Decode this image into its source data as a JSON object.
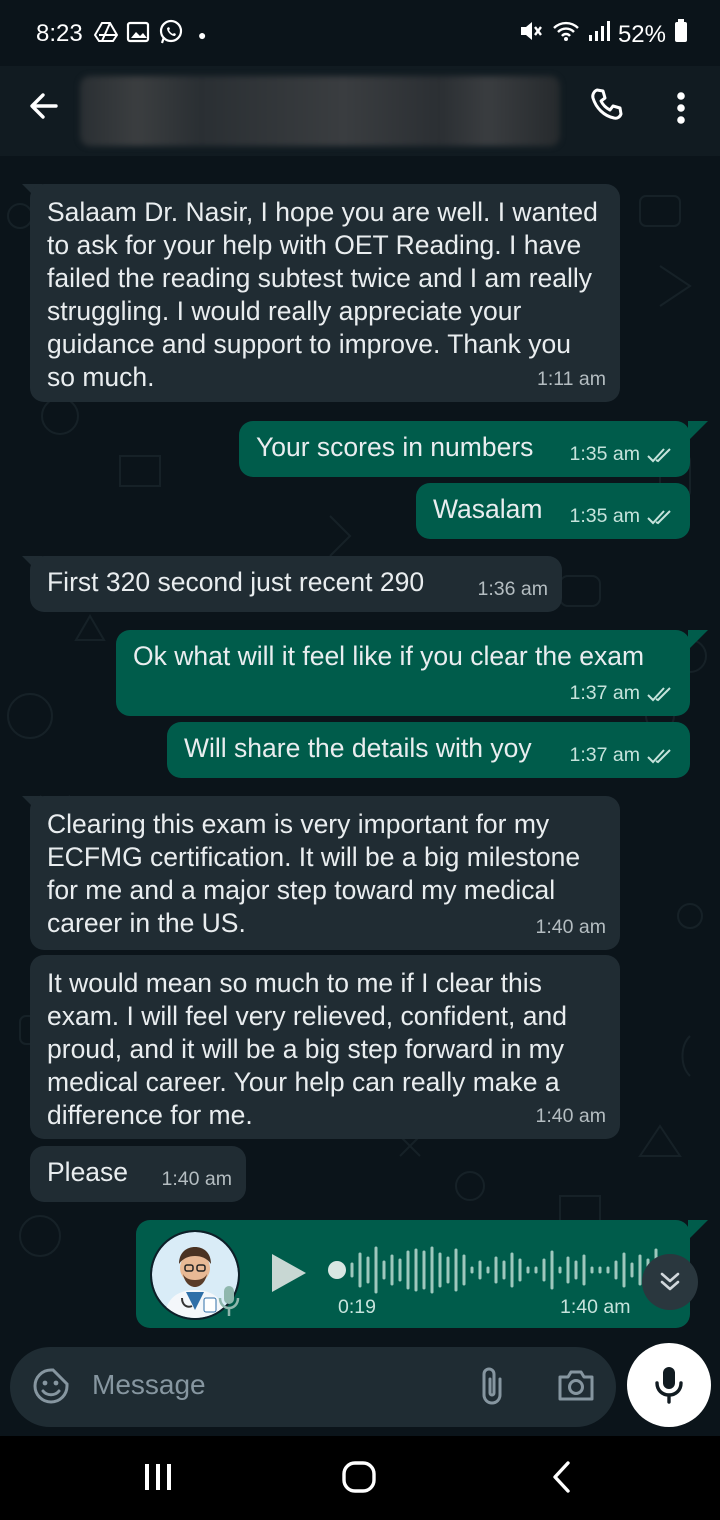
{
  "status_bar": {
    "time": "8:23",
    "battery": "52%"
  },
  "header": {
    "contact_name": ""
  },
  "messages": [
    {
      "dir": "in",
      "text": "Salaam Dr. Nasir, I hope you are well. I wanted to ask for your help with OET Reading. I have failed the reading subtest twice and I am really struggling. I would really appreciate your guidance and support to improve. Thank you so much.",
      "time": "1:11 am"
    },
    {
      "dir": "out",
      "text": "Your scores in numbers",
      "time": "1:35 am",
      "read": true
    },
    {
      "dir": "out",
      "text": "Wasalam",
      "time": "1:35 am",
      "read": true
    },
    {
      "dir": "in",
      "text": "First 320 second just recent 290",
      "time": "1:36 am"
    },
    {
      "dir": "out",
      "text": "Ok what will it feel like if you clear the exam",
      "time": "1:37 am",
      "read": true
    },
    {
      "dir": "out",
      "text": "Will share the details with yoy",
      "time": "1:37 am",
      "read": true
    },
    {
      "dir": "in",
      "text": "Clearing this exam is very important for my ECFMG certification. It will be a big milestone for me and a major step toward my medical career in the US.",
      "time": "1:40 am"
    },
    {
      "dir": "in",
      "text": "It would mean so much to me if I clear this exam. I will feel very relieved, confident, and proud, and it will be a big step forward in my medical career. Your help can really make a difference for me.",
      "time": "1:40 am"
    },
    {
      "dir": "in",
      "text": "Please",
      "time": "1:40 am"
    }
  ],
  "voice_note": {
    "duration": "0:19",
    "time": "1:40 am",
    "played": false
  },
  "composer": {
    "placeholder": "Message"
  },
  "icons": {
    "back": "arrow-left-icon",
    "call": "phone-icon",
    "menu": "more-vert-icon",
    "emoji": "sticker-icon",
    "attach": "paperclip-icon",
    "camera": "camera-icon",
    "mic": "mic-icon",
    "scroll": "double-chevron-down-icon"
  },
  "colors": {
    "incoming": "#202c33",
    "outgoing": "#005c4b",
    "background": "#0b141a",
    "read_tick": "#c6e3dc"
  }
}
